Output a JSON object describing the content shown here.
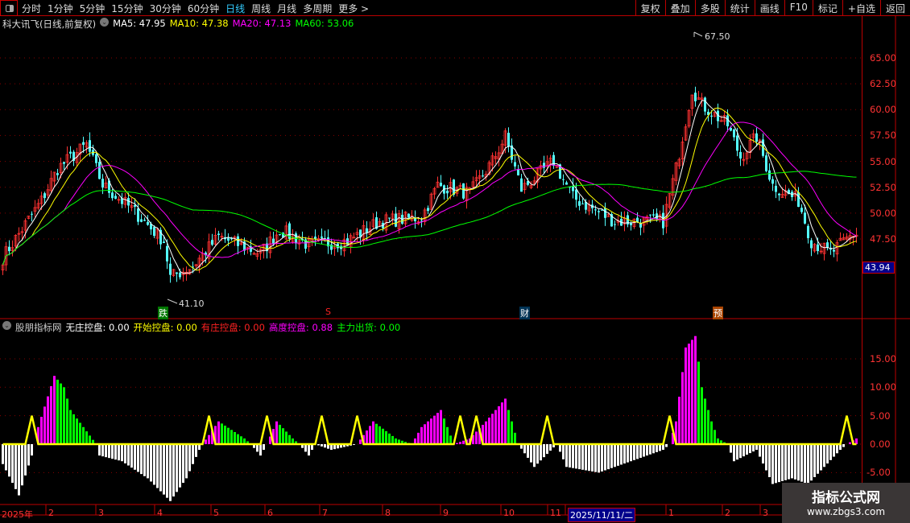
{
  "toolbar": {
    "periods": [
      "分时",
      "1分钟",
      "5分钟",
      "15分钟",
      "30分钟",
      "60分钟",
      "日线",
      "周线",
      "月线",
      "多周期",
      "更多 >"
    ],
    "active_period": "日线",
    "tools": [
      "复权",
      "叠加",
      "多股",
      "统计",
      "画线",
      "F10",
      "标记",
      "+自选",
      "返回"
    ]
  },
  "main_legend": {
    "title": "科大讯飞(日线,前复权)",
    "ma5": "MA5: 47.95",
    "ma10": "MA10: 47.38",
    "ma20": "MA20: 47.13",
    "ma60": "MA60: 53.06"
  },
  "sub_legend": {
    "title": "股朋指标网",
    "a": "无庄控盘: 0.00",
    "b": "开始控盘: 0.00",
    "c": "有庄控盘: 0.00",
    "d": "高度控盘: 0.88",
    "e": "主力出货: 0.00"
  },
  "price_axis": [
    "65.00",
    "62.50",
    "60.00",
    "57.50",
    "55.00",
    "52.50",
    "50.00",
    "47.50"
  ],
  "current_price_label": "43.94",
  "ind_axis": [
    "15.00",
    "10.00",
    "5.00",
    "0.00",
    "-5.00"
  ],
  "annotations": {
    "high": "67.50",
    "low": "41.10",
    "marks": [
      "跌",
      "S",
      "财",
      "预"
    ]
  },
  "date_axis": [
    "2025年",
    "2",
    "3",
    "4",
    "5",
    "6",
    "7",
    "8",
    "9",
    "10",
    "11",
    "2025/11/11/二",
    "1",
    "2",
    "3"
  ],
  "watermark": {
    "title": "指标公式网",
    "url": "www.zbgs3.com"
  },
  "colors": {
    "up": "#ff3232",
    "down": "#54ffff",
    "ma5": "#ffffff",
    "ma10": "#ffff00",
    "ma20": "#ff00ff",
    "ma60": "#00ff00",
    "axis": "#bb0000"
  },
  "chart_data": {
    "type": "candlestick",
    "price_keypoints_bar_price": [
      [
        0,
        45.7
      ],
      [
        12,
        51.2
      ],
      [
        17,
        54.3
      ],
      [
        26,
        56.6
      ],
      [
        31,
        52.7
      ],
      [
        40,
        50.4
      ],
      [
        50,
        47.3
      ],
      [
        52,
        43.8
      ],
      [
        59,
        44.9
      ],
      [
        67,
        47.7
      ],
      [
        80,
        46.1
      ],
      [
        86,
        48.4
      ],
      [
        95,
        46.9
      ],
      [
        107,
        47.3
      ],
      [
        117,
        49.2
      ],
      [
        130,
        49.6
      ],
      [
        135,
        52.7
      ],
      [
        145,
        51.9
      ],
      [
        152,
        55
      ],
      [
        156,
        57.4
      ],
      [
        161,
        52.3
      ],
      [
        171,
        55
      ],
      [
        177,
        51.5
      ],
      [
        190,
        49.2
      ],
      [
        205,
        49.2
      ],
      [
        209,
        54.3
      ],
      [
        214,
        62
      ],
      [
        217,
        60.5
      ],
      [
        225,
        58.5
      ],
      [
        229,
        55.4
      ],
      [
        234,
        57.4
      ],
      [
        239,
        52.7
      ],
      [
        247,
        51.2
      ],
      [
        251,
        47.3
      ],
      [
        257,
        46.1
      ],
      [
        264,
        48
      ]
    ],
    "indicator_keypoints_bar_value": [
      [
        0,
        -3.5
      ],
      [
        5,
        -9
      ],
      [
        9,
        -2
      ],
      [
        10,
        0
      ],
      [
        11,
        3
      ],
      [
        16,
        12
      ],
      [
        19,
        10
      ],
      [
        21,
        6
      ],
      [
        29,
        0
      ],
      [
        30,
        -2
      ],
      [
        37,
        -3
      ],
      [
        45,
        -6
      ],
      [
        52,
        -10
      ],
      [
        57,
        -6
      ],
      [
        61,
        -1
      ],
      [
        62,
        0
      ],
      [
        67,
        4
      ],
      [
        75,
        1
      ],
      [
        77,
        0
      ],
      [
        80,
        -2
      ],
      [
        82,
        0
      ],
      [
        85,
        4
      ],
      [
        90,
        1
      ],
      [
        92,
        0
      ],
      [
        95,
        -2
      ],
      [
        97,
        0
      ],
      [
        102,
        -1
      ],
      [
        110,
        0
      ],
      [
        115,
        4
      ],
      [
        122,
        1
      ],
      [
        127,
        0
      ],
      [
        130,
        3
      ],
      [
        136,
        6
      ],
      [
        140,
        0
      ],
      [
        145,
        1
      ],
      [
        150,
        4
      ],
      [
        156,
        8
      ],
      [
        160,
        0
      ],
      [
        165,
        -4
      ],
      [
        172,
        0
      ],
      [
        175,
        -4
      ],
      [
        185,
        -5
      ],
      [
        195,
        -3
      ],
      [
        200,
        -2
      ],
      [
        205,
        -1
      ],
      [
        207,
        0
      ],
      [
        209,
        4
      ],
      [
        212,
        17
      ],
      [
        215,
        19
      ],
      [
        217,
        10
      ],
      [
        220,
        4
      ],
      [
        222,
        1
      ],
      [
        225,
        0
      ],
      [
        227,
        -3
      ],
      [
        234,
        -1
      ],
      [
        239,
        -7
      ],
      [
        245,
        -6
      ],
      [
        250,
        -7
      ],
      [
        260,
        -1
      ],
      [
        262,
        0
      ],
      [
        265,
        1
      ]
    ],
    "signal_spike_bars": [
      9,
      64,
      82,
      99,
      110,
      142,
      147,
      169,
      207,
      262
    ],
    "signal_peak": 5,
    "ylim_price": [
      41,
      68
    ],
    "ylim_indicator": [
      -11,
      20
    ]
  }
}
